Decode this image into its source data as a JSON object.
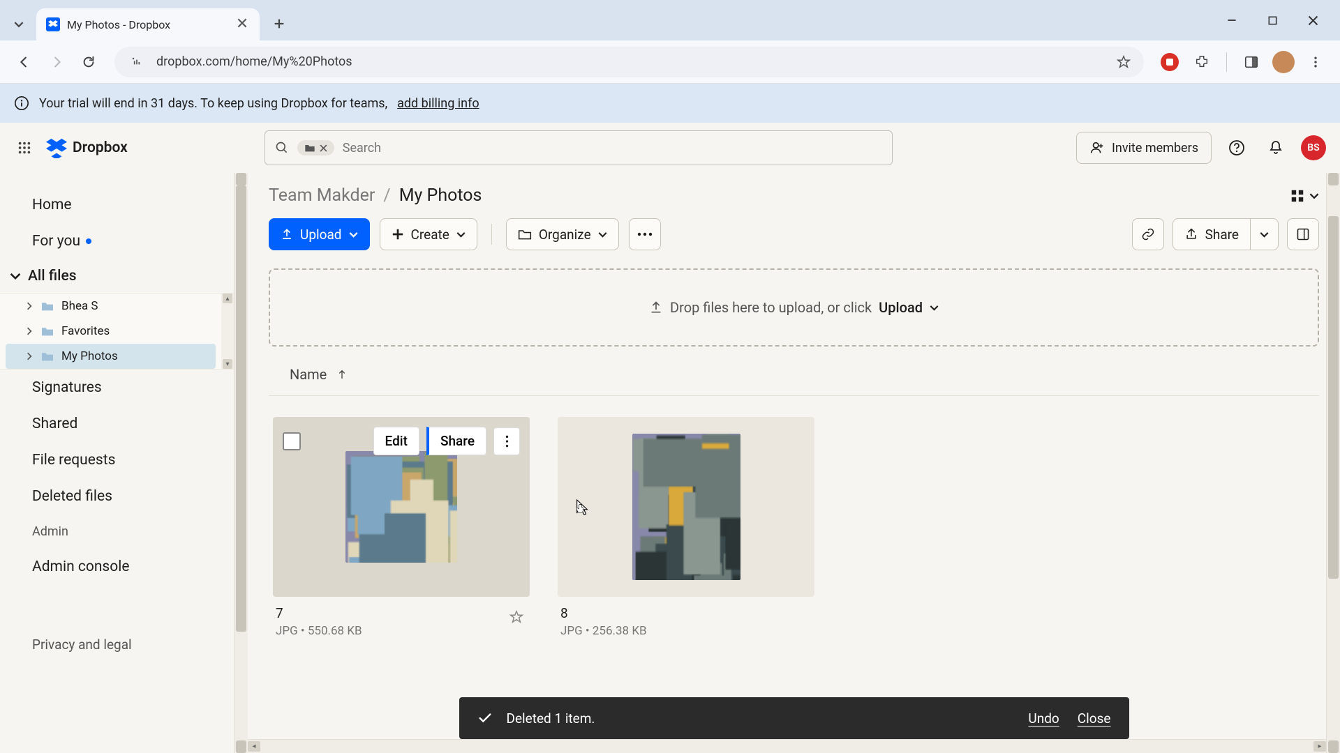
{
  "browser": {
    "tab_title": "My Photos - Dropbox",
    "url": "dropbox.com/home/My%20Photos"
  },
  "trial_banner": {
    "text_prefix": "Your trial will end in 31 days. To keep using Dropbox for teams, ",
    "link": "add billing info"
  },
  "header": {
    "logo_text": "Dropbox",
    "search_placeholder": "Search",
    "invite_label": "Invite members",
    "user_initials": "BS"
  },
  "sidebar": {
    "home": "Home",
    "for_you": "For you",
    "all_files": "All files",
    "tree": [
      {
        "label": "Bhea S"
      },
      {
        "label": "Favorites"
      },
      {
        "label": "My Photos"
      }
    ],
    "signatures": "Signatures",
    "shared": "Shared",
    "file_requests": "File requests",
    "deleted_files": "Deleted files",
    "admin": "Admin",
    "admin_console": "Admin console",
    "privacy": "Privacy and legal"
  },
  "breadcrumb": {
    "parent": "Team Makder",
    "current": "My Photos"
  },
  "actions": {
    "upload": "Upload",
    "create": "Create",
    "organize": "Organize",
    "share": "Share"
  },
  "dropzone": {
    "text": "Drop files here to upload, or click",
    "upload": "Upload"
  },
  "list_header": {
    "name": "Name"
  },
  "hover": {
    "edit": "Edit",
    "share": "Share"
  },
  "files": [
    {
      "name": "7",
      "type": "JPG",
      "size": "550.68 KB"
    },
    {
      "name": "8",
      "type": "JPG",
      "size": "256.38 KB"
    }
  ],
  "toast": {
    "message": "Deleted 1 item.",
    "undo": "Undo",
    "close": "Close"
  }
}
